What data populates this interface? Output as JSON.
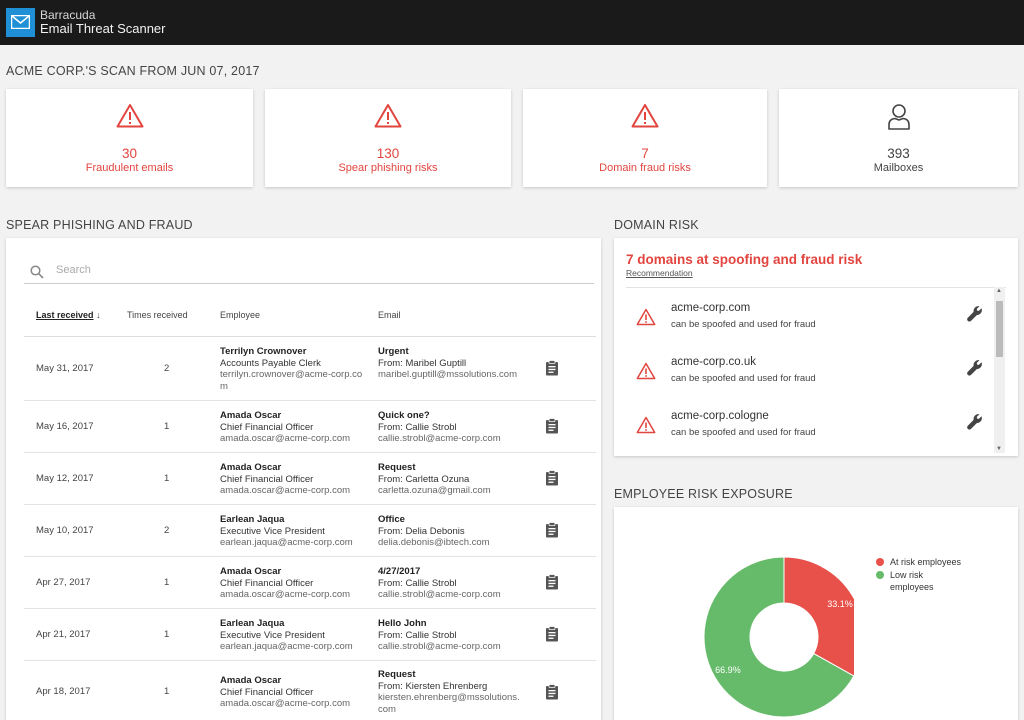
{
  "app": {
    "brand_line1": "Barracuda",
    "brand_line2": "Email Threat Scanner",
    "accent_color": "#1f8fd6",
    "danger_color": "#e2453f"
  },
  "scan_title": "ACME CORP.'S SCAN FROM JUN 07, 2017",
  "stats": [
    {
      "value": "30",
      "label": "Fraudulent emails",
      "icon": "warning-icon"
    },
    {
      "value": "130",
      "label": "Spear phishing risks",
      "icon": "warning-icon"
    },
    {
      "value": "7",
      "label": "Domain fraud risks",
      "icon": "warning-icon"
    },
    {
      "value": "393",
      "label": "Mailboxes",
      "icon": "user-icon"
    }
  ],
  "spear": {
    "title": "SPEAR PHISHING AND FRAUD",
    "search_placeholder": "Search",
    "columns": {
      "last_received": "Last received",
      "sort_arrow": "↓",
      "times_received": "Times received",
      "employee": "Employee",
      "email": "Email"
    },
    "rows": [
      {
        "date": "May 31, 2017",
        "times": "2",
        "emp_name": "Terrilyn Crownover",
        "emp_title": "Accounts Payable Clerk",
        "emp_email": "terrilyn.crownover@acme-corp.com",
        "subject": "Urgent",
        "from": "From: Maribel Guptill",
        "from_email": "maribel.guptill@mssolutions.com"
      },
      {
        "date": "May 16, 2017",
        "times": "1",
        "emp_name": "Amada Oscar",
        "emp_title": "Chief Financial Officer",
        "emp_email": "amada.oscar@acme-corp.com",
        "subject": "Quick one?",
        "from": "From: Callie Strobl",
        "from_email": "callie.strobl@acme-corp.com"
      },
      {
        "date": "May 12, 2017",
        "times": "1",
        "emp_name": "Amada Oscar",
        "emp_title": "Chief Financial Officer",
        "emp_email": "amada.oscar@acme-corp.com",
        "subject": "Request",
        "from": "From: Carletta Ozuna",
        "from_email": "carletta.ozuna@gmail.com"
      },
      {
        "date": "May 10, 2017",
        "times": "2",
        "emp_name": "Earlean Jaqua",
        "emp_title": "Executive Vice President",
        "emp_email": "earlean.jaqua@acme-corp.com",
        "subject": "Office",
        "from": "From: Delia Debonis",
        "from_email": "delia.debonis@ibtech.com"
      },
      {
        "date": "Apr 27, 2017",
        "times": "1",
        "emp_name": "Amada Oscar",
        "emp_title": "Chief Financial Officer",
        "emp_email": "amada.oscar@acme-corp.com",
        "subject": "4/27/2017",
        "from": "From: Callie Strobl",
        "from_email": "callie.strobl@acme-corp.com"
      },
      {
        "date": "Apr 21, 2017",
        "times": "1",
        "emp_name": "Earlean Jaqua",
        "emp_title": "Executive Vice President",
        "emp_email": "earlean.jaqua@acme-corp.com",
        "subject": "Hello John",
        "from": "From: Callie Strobl",
        "from_email": "callie.strobl@acme-corp.com"
      },
      {
        "date": "Apr 18, 2017",
        "times": "1",
        "emp_name": "Amada Oscar",
        "emp_title": "Chief Financial Officer",
        "emp_email": "amada.oscar@acme-corp.com",
        "subject": "Request",
        "from": "From: Kiersten Ehrenberg",
        "from_email": "kiersten.ehrenberg@mssolutions.com"
      }
    ]
  },
  "domain": {
    "title": "DOMAIN RISK",
    "headline": "7 domains at spoofing and fraud risk",
    "recommendation": "Recommendation",
    "items": [
      {
        "name": "acme-corp.com",
        "desc": "can be spoofed and used for fraud"
      },
      {
        "name": "acme-corp.co.uk",
        "desc": "can be spoofed and used for fraud"
      },
      {
        "name": "acme-corp.cologne",
        "desc": "can be spoofed and used for fraud"
      }
    ]
  },
  "exposure": {
    "title": "EMPLOYEE RISK EXPOSURE"
  },
  "chart_data": {
    "type": "pie",
    "donut": true,
    "legend_position": "right",
    "series": [
      {
        "name": "At risk employees",
        "value": 33.1,
        "label": "33.1%",
        "color": "#e8504a"
      },
      {
        "name": "Low risk employees",
        "value": 66.9,
        "label": "66.9%",
        "color": "#66bb6a"
      }
    ]
  }
}
